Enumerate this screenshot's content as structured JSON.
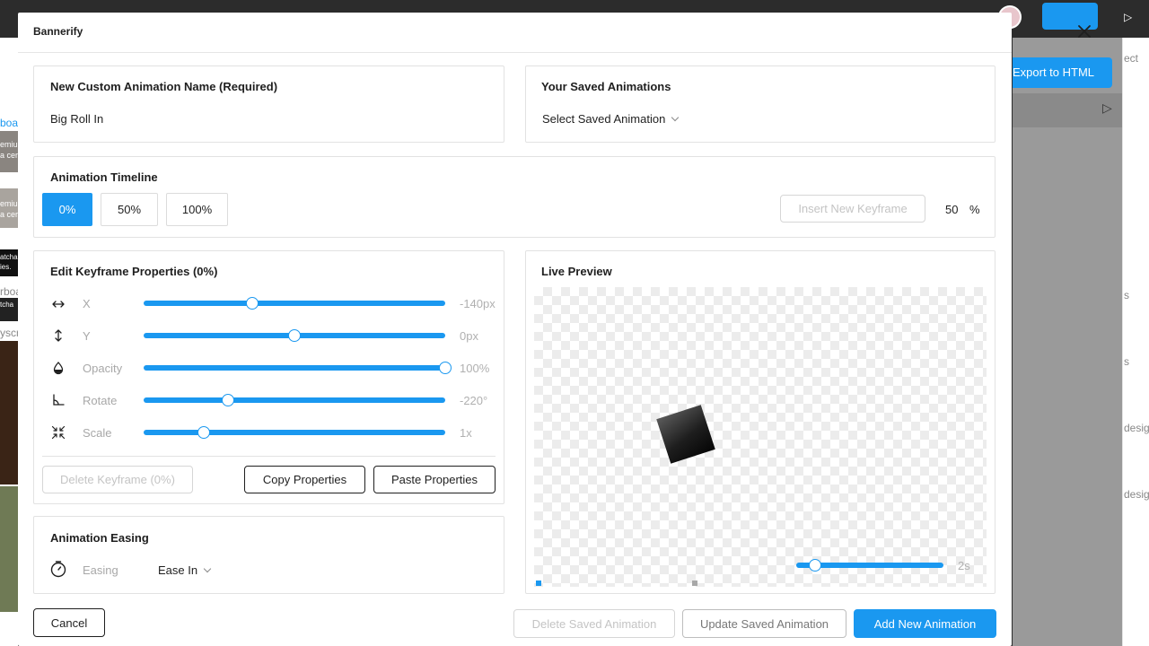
{
  "background": {
    "export_label": "Export to HTML",
    "panel_texts": [
      "ect",
      "s",
      "s",
      "desig",
      "desig"
    ],
    "left_texts": [
      "boa",
      "emiu",
      "a cer",
      "emiu",
      "a cer",
      "atcha",
      "ies.",
      "rboa",
      "tcha",
      "yscr"
    ]
  },
  "modal": {
    "title": "Bannerify",
    "close_icon": "close-icon"
  },
  "name_card": {
    "title": "New Custom Animation Name (Required)",
    "value": "Big Roll In"
  },
  "saved_card": {
    "title": "Your Saved Animations",
    "select_value": "Select Saved Animation"
  },
  "timeline": {
    "title": "Animation Timeline",
    "tabs": [
      {
        "label": "0%",
        "active": true
      },
      {
        "label": "50%",
        "active": false
      },
      {
        "label": "100%",
        "active": false
      }
    ],
    "insert_label": "Insert New Keyframe",
    "percent_value": "50",
    "percent_unit": "%"
  },
  "keyframe": {
    "title": "Edit Keyframe Properties (0%)",
    "properties": [
      {
        "label": "X",
        "value": "-140px",
        "slider": 0.36,
        "icon": "horizontal-arrows-icon"
      },
      {
        "label": "Y",
        "value": "0px",
        "slider": 0.5,
        "icon": "vertical-arrows-icon"
      },
      {
        "label": "Opacity",
        "value": "100%",
        "slider": 1.0,
        "icon": "drop-icon"
      },
      {
        "label": "Rotate",
        "value": "-220°",
        "slider": 0.28,
        "icon": "angle-icon"
      },
      {
        "label": "Scale",
        "value": "1x",
        "slider": 0.2,
        "icon": "compress-icon"
      }
    ],
    "delete_label": "Delete Keyframe (0%)",
    "copy_label": "Copy Properties",
    "paste_label": "Paste Properties"
  },
  "easing": {
    "title": "Animation Easing",
    "label": "Easing",
    "value": "Ease In",
    "icon": "stopwatch-icon"
  },
  "preview": {
    "title": "Live Preview",
    "duration": "2s",
    "scrub": 0.13
  },
  "footer": {
    "cancel_label": "Cancel",
    "delete_saved_label": "Delete Saved Animation",
    "update_saved_label": "Update Saved Animation",
    "add_label": "Add New Animation"
  },
  "colors": {
    "accent": "#1a98f0",
    "border": "#e2e2e2"
  }
}
